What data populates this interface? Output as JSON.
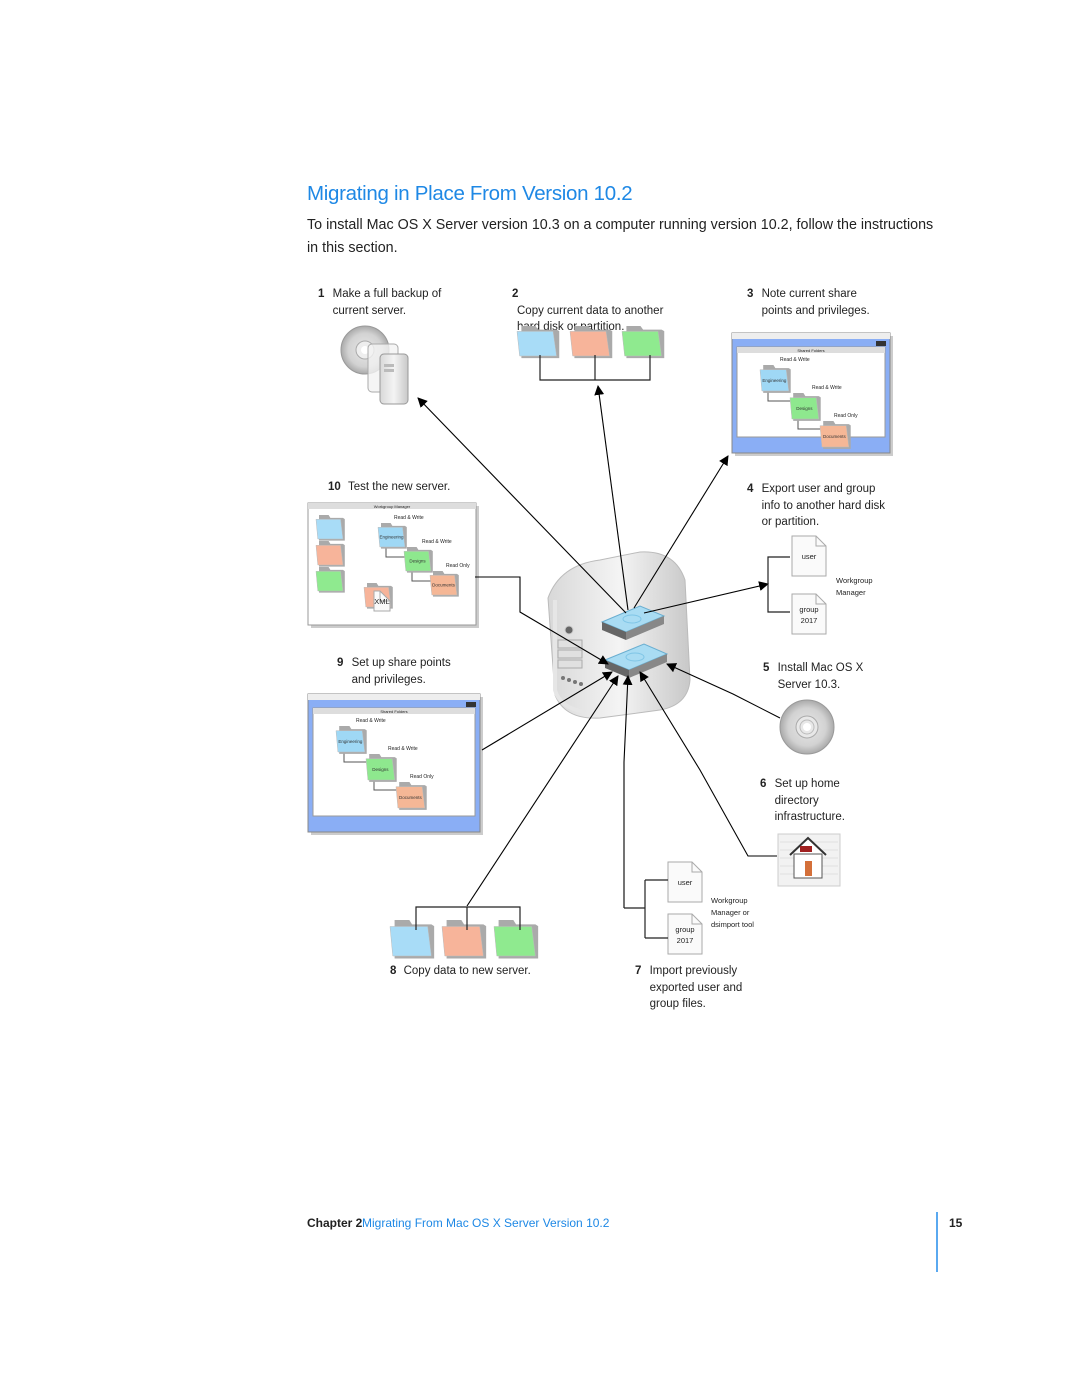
{
  "heading": "Migrating in Place From Version 10.2",
  "intro": "To install Mac OS X Server version 10.3 on a computer running version 10.2, follow the instructions in this section.",
  "steps": [
    {
      "num": "1",
      "text": "Make a full backup of current server."
    },
    {
      "num": "2",
      "text": "Copy current data to another hard disk or partition."
    },
    {
      "num": "3",
      "text": "Note current share points and privileges."
    },
    {
      "num": "4",
      "text": "Export user and group info to another hard disk or partition."
    },
    {
      "num": "5",
      "text": "Install Mac OS X Server 10.3."
    },
    {
      "num": "6",
      "text": "Set up home directory infrastructure."
    },
    {
      "num": "7",
      "text": "Import previously exported user and group files."
    },
    {
      "num": "8",
      "text": "Copy data to new server."
    },
    {
      "num": "9",
      "text": "Set up share points and privileges."
    },
    {
      "num": "10",
      "text": "Test the new server."
    }
  ],
  "share_window": {
    "title": "Shared Folders",
    "folders": [
      {
        "name": "Engineering",
        "privilege": "Read & Write",
        "color": "#9fd8f5"
      },
      {
        "name": "Designs",
        "privilege": "Read & Write",
        "color": "#8ee88e"
      },
      {
        "name": "Documents",
        "privilege": "Read Only",
        "color": "#f5b796"
      }
    ]
  },
  "test_window": {
    "title": "Workgroup Manager",
    "xml_label": "XML"
  },
  "export_files": {
    "user_label": "user",
    "group_label": "group",
    "group_id": "2017",
    "tool_lines": [
      "Workgroup",
      "Manager"
    ]
  },
  "import_files": {
    "user_label": "user",
    "group_label": "group",
    "group_id": "2017",
    "tool_lines": [
      "Workgroup",
      "Manager or",
      "dsimport tool"
    ]
  },
  "folder_colors": [
    "#a8dcf7",
    "#f7b49a",
    "#8fea8f"
  ],
  "footer": {
    "chapter": "Chapter 2",
    "title": "Migrating From Mac OS X Server Version 10.2",
    "page": "15"
  }
}
